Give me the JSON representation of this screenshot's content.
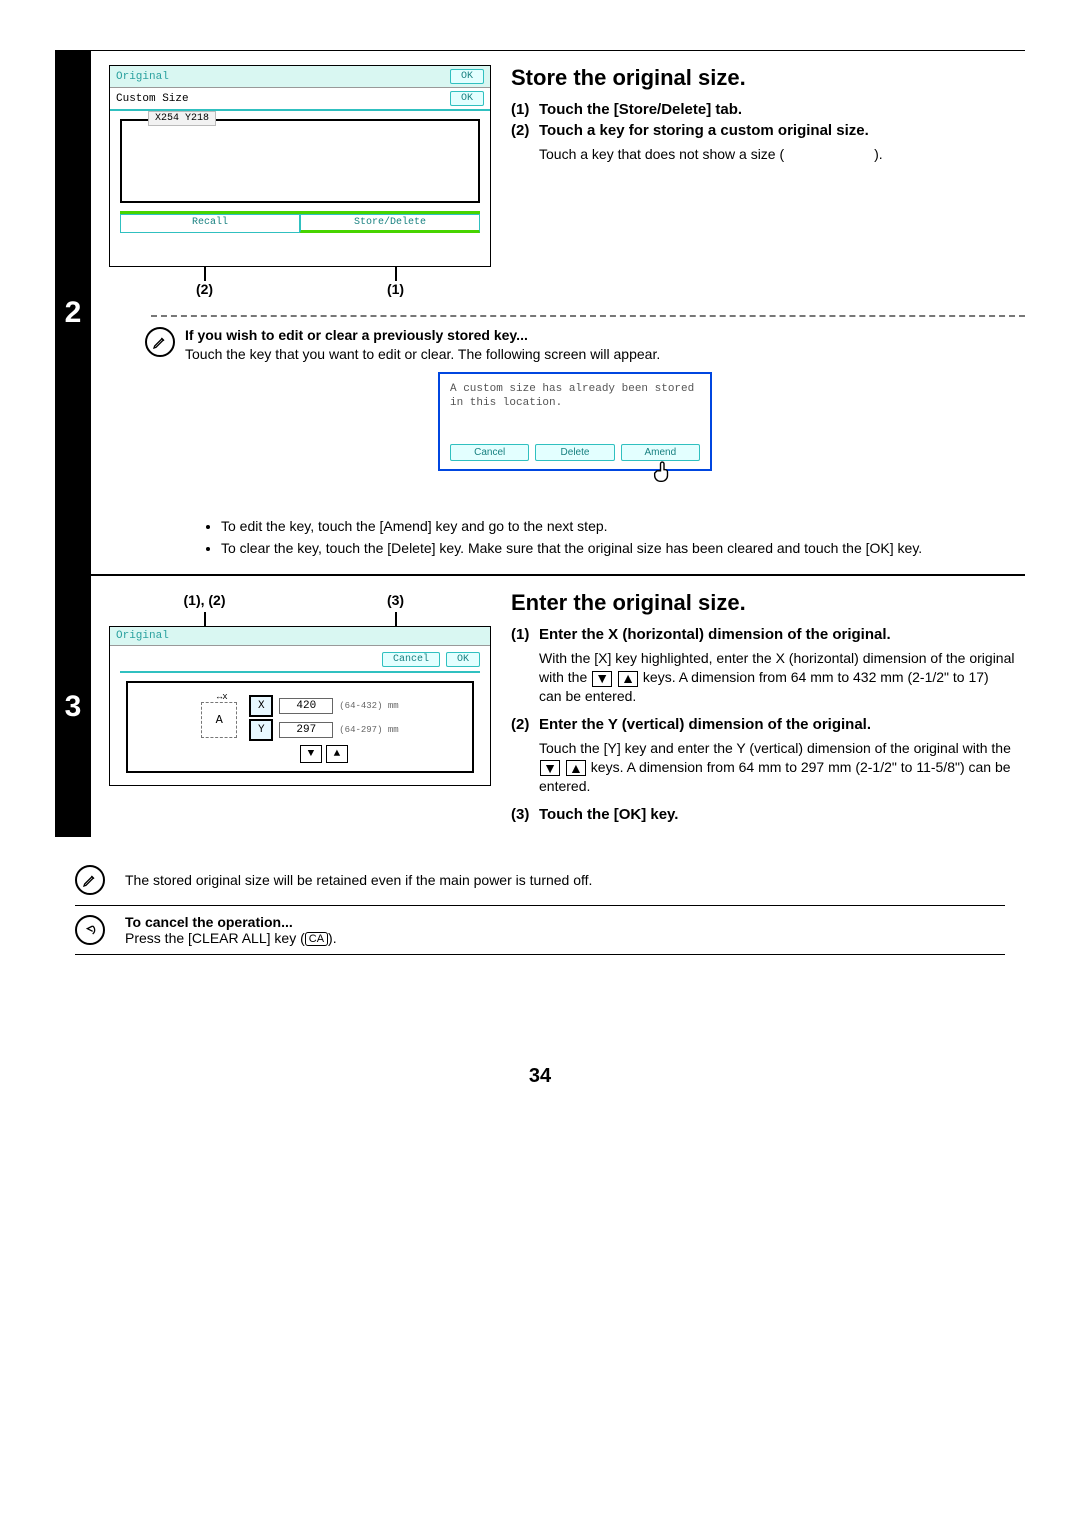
{
  "page_number": "34",
  "step2": {
    "number": "2",
    "title": "Store the original size.",
    "instr1_num": "(1)",
    "instr1": "Touch the [Store/Delete] tab.",
    "instr2_num": "(2)",
    "instr2": "Touch a key for storing a custom original size.",
    "instr2_body_a": "Touch a key that does not show a size (",
    "instr2_body_b": ").",
    "note_title": "If you wish to edit or clear a previously stored key...",
    "note_text": "Touch the key that you want to edit or clear. The following screen will appear.",
    "bullet1": "To edit the key, touch the [Amend] key and go to the next step.",
    "bullet2": "To clear the key, touch the [Delete] key. Make sure that the original size has been cleared and touch the [OK] key.",
    "callout1": "(2)",
    "callout2": "(1)",
    "fig": {
      "title": "Original",
      "ok": "OK",
      "subtitle": "Custom Size",
      "size_tag": "X254 Y218",
      "tab_recall": "Recall",
      "tab_store": "Store/Delete"
    },
    "popup": {
      "line1": "A custom size has already been stored",
      "line2": "in this location.",
      "cancel": "Cancel",
      "delete": "Delete",
      "amend": "Amend"
    }
  },
  "step3": {
    "number": "3",
    "title": "Enter the original size.",
    "callout_left": "(1), (2)",
    "callout_right": "(3)",
    "instr1_num": "(1)",
    "instr1": "Enter the X (horizontal) dimension of the original.",
    "instr1_body_a": "With the [X] key highlighted, enter the X (horizontal) dimension of the original with the ",
    "instr1_body_b": " keys. A dimension from 64 mm to 432 mm (2-1/2\" to 17) can be entered.",
    "instr2_num": "(2)",
    "instr2": "Enter the Y (vertical) dimension of the original.",
    "instr2_body_a": "Touch the [Y] key and enter the Y (vertical) dimension of the original with the ",
    "instr2_body_b": " keys. A dimension from 64 mm to 297 mm (2-1/2\" to 11-5/8\") can be entered.",
    "instr3_num": "(3)",
    "instr3": "Touch the [OK] key.",
    "fig": {
      "title": "Original",
      "cancel": "Cancel",
      "ok": "OK",
      "schematic": "A",
      "x_label": "X",
      "x_val": "420",
      "x_range": "(64-432)\nmm",
      "y_label": "Y",
      "y_val": "297",
      "y_range": "(64-297)\nmm"
    }
  },
  "footnote1": "The stored original size will be retained even if the main power is turned off.",
  "foot2_title": "To cancel the operation...",
  "foot2_body_a": "Press the [CLEAR ALL] key (",
  "foot2_body_b": ").",
  "ca_label": "CA"
}
